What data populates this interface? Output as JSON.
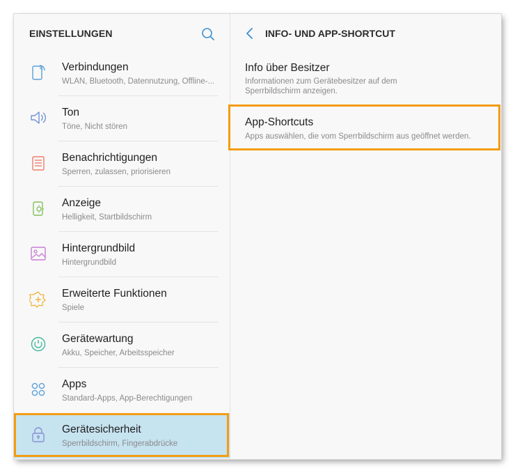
{
  "left_panel": {
    "title": "EINSTELLUNGEN",
    "items": [
      {
        "label": "Verbindungen",
        "sub": "WLAN, Bluetooth, Datennutzung, Offline-...",
        "icon": "connections-icon",
        "color": "#5aa0d8"
      },
      {
        "label": "Ton",
        "sub": "Töne, Nicht stören",
        "icon": "speaker-icon",
        "color": "#6f8fd8"
      },
      {
        "label": "Benachrichtigungen",
        "sub": "Sperren, zulassen, priorisieren",
        "icon": "notification-icon",
        "color": "#ef7d6b"
      },
      {
        "label": "Anzeige",
        "sub": "Helligkeit, Startbildschirm",
        "icon": "display-icon",
        "color": "#7fc05a"
      },
      {
        "label": "Hintergrundbild",
        "sub": "Hintergrundbild",
        "icon": "wallpaper-icon",
        "color": "#c77cd6"
      },
      {
        "label": "Erweiterte Funktionen",
        "sub": "Spiele",
        "icon": "advanced-features-icon",
        "color": "#f0b43c"
      },
      {
        "label": "Gerätewartung",
        "sub": "Akku, Speicher, Arbeitsspeicher",
        "icon": "device-maintenance-icon",
        "color": "#3fb89a"
      },
      {
        "label": "Apps",
        "sub": "Standard-Apps, App-Berechtigungen",
        "icon": "apps-icon",
        "color": "#5aa0d8"
      },
      {
        "label": "Gerätesicherheit",
        "sub": "Sperrbildschirm, Fingerabdrücke",
        "icon": "lock-icon",
        "color": "#8a8fd6"
      }
    ]
  },
  "right_panel": {
    "title": "INFO- UND APP-SHORTCUT",
    "items": [
      {
        "label": "Info über Besitzer",
        "sub": "Informationen zum Gerätebesitzer auf dem Sperrbildschirm anzeigen."
      },
      {
        "label": "App-Shortcuts",
        "sub": "Apps auswählen, die vom Sperrbildschirm aus geöffnet werden."
      }
    ]
  },
  "colors": {
    "accent": "#3a8fd0",
    "highlight_outline": "#f39c12",
    "active_background": "#c6e3f0"
  }
}
